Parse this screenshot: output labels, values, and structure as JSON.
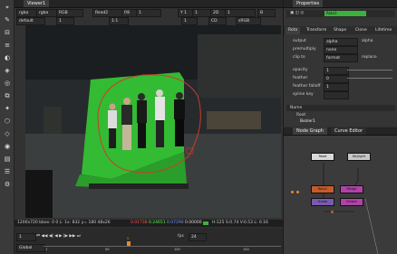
{
  "viewer": {
    "tab_title": "Viewer1",
    "toolbar_row1": {
      "channels": "rgba",
      "layer": "rgba",
      "colorspace": "RGB",
      "input_b": "Read2",
      "gain": "f/8",
      "gain_value": "1",
      "mix_value": "1",
      "zoom": "Y 1",
      "gamma": "1",
      "view_label": "2D",
      "mode": "B"
    },
    "toolbar_row2": {
      "default": "default",
      "frame": "1",
      "proxy": "1:1",
      "zoom_label": "1",
      "cd": "CD",
      "colorspace": "sRGB"
    },
    "info_text": "1200x720 bbox: 0 0 L: 1x: 832 y= 180 48x26",
    "info_values": {
      "r": "0.01738",
      "g": "0.24651",
      "b": "0.07290",
      "a": "0.00000",
      "hsv": "H:125 S:0.74 V:0.53 L: 0.16"
    },
    "timeline": {
      "frame": "1",
      "fps_label": "fps",
      "fps": "24",
      "play_mode": "Global",
      "ticks": [
        "1",
        "50",
        "100",
        "150"
      ],
      "marker_frame": "5"
    }
  },
  "properties": {
    "title": "Properties",
    "node_name": "Roto1",
    "tabs": [
      "Roto",
      "Transform",
      "Shape",
      "Clone",
      "Lifetime"
    ],
    "rows": [
      {
        "label": "output",
        "value": "alpha"
      },
      {
        "label": "premultiply",
        "value": "none"
      },
      {
        "label": "clip to",
        "value": "format"
      },
      {
        "label": "opacity",
        "value": "1"
      },
      {
        "label": "feather",
        "value": "0"
      },
      {
        "label": "feather falloff",
        "value": "1"
      },
      {
        "label": "spline key",
        "value": ""
      }
    ],
    "output_extra": "alpha",
    "replace_label": "replace",
    "list_header": "Name",
    "list_items": [
      "Root",
      "Bezier1"
    ]
  },
  "node_graph": {
    "tabs": [
      "Node Graph",
      "Curve Editor"
    ],
    "nodes": [
      "Read",
      "Keylight",
      "Roto1",
      "Merge",
      "Grade",
      "Viewer"
    ]
  },
  "colors": {
    "accent_green": "#3bb23b",
    "roto_curve": "#d03a2a",
    "node_red": "#c85a2a",
    "node_purple": "#7a5ab0",
    "node_magenta": "#b042a8"
  }
}
